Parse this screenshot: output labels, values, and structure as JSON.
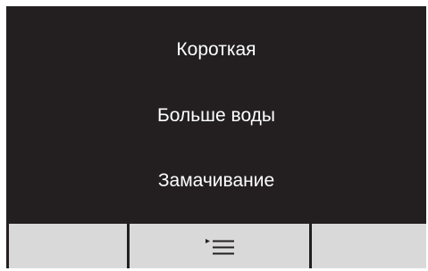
{
  "menu": {
    "items": [
      {
        "label": "Короткая"
      },
      {
        "label": "Больше воды"
      },
      {
        "label": "Замачивание"
      }
    ]
  },
  "bottom_bar": {
    "center_icon": "list-menu-icon"
  },
  "colors": {
    "screen_background": "#231f20",
    "text": "#ffffff",
    "button_background": "#d9d9d9",
    "icon": "#231f20"
  }
}
